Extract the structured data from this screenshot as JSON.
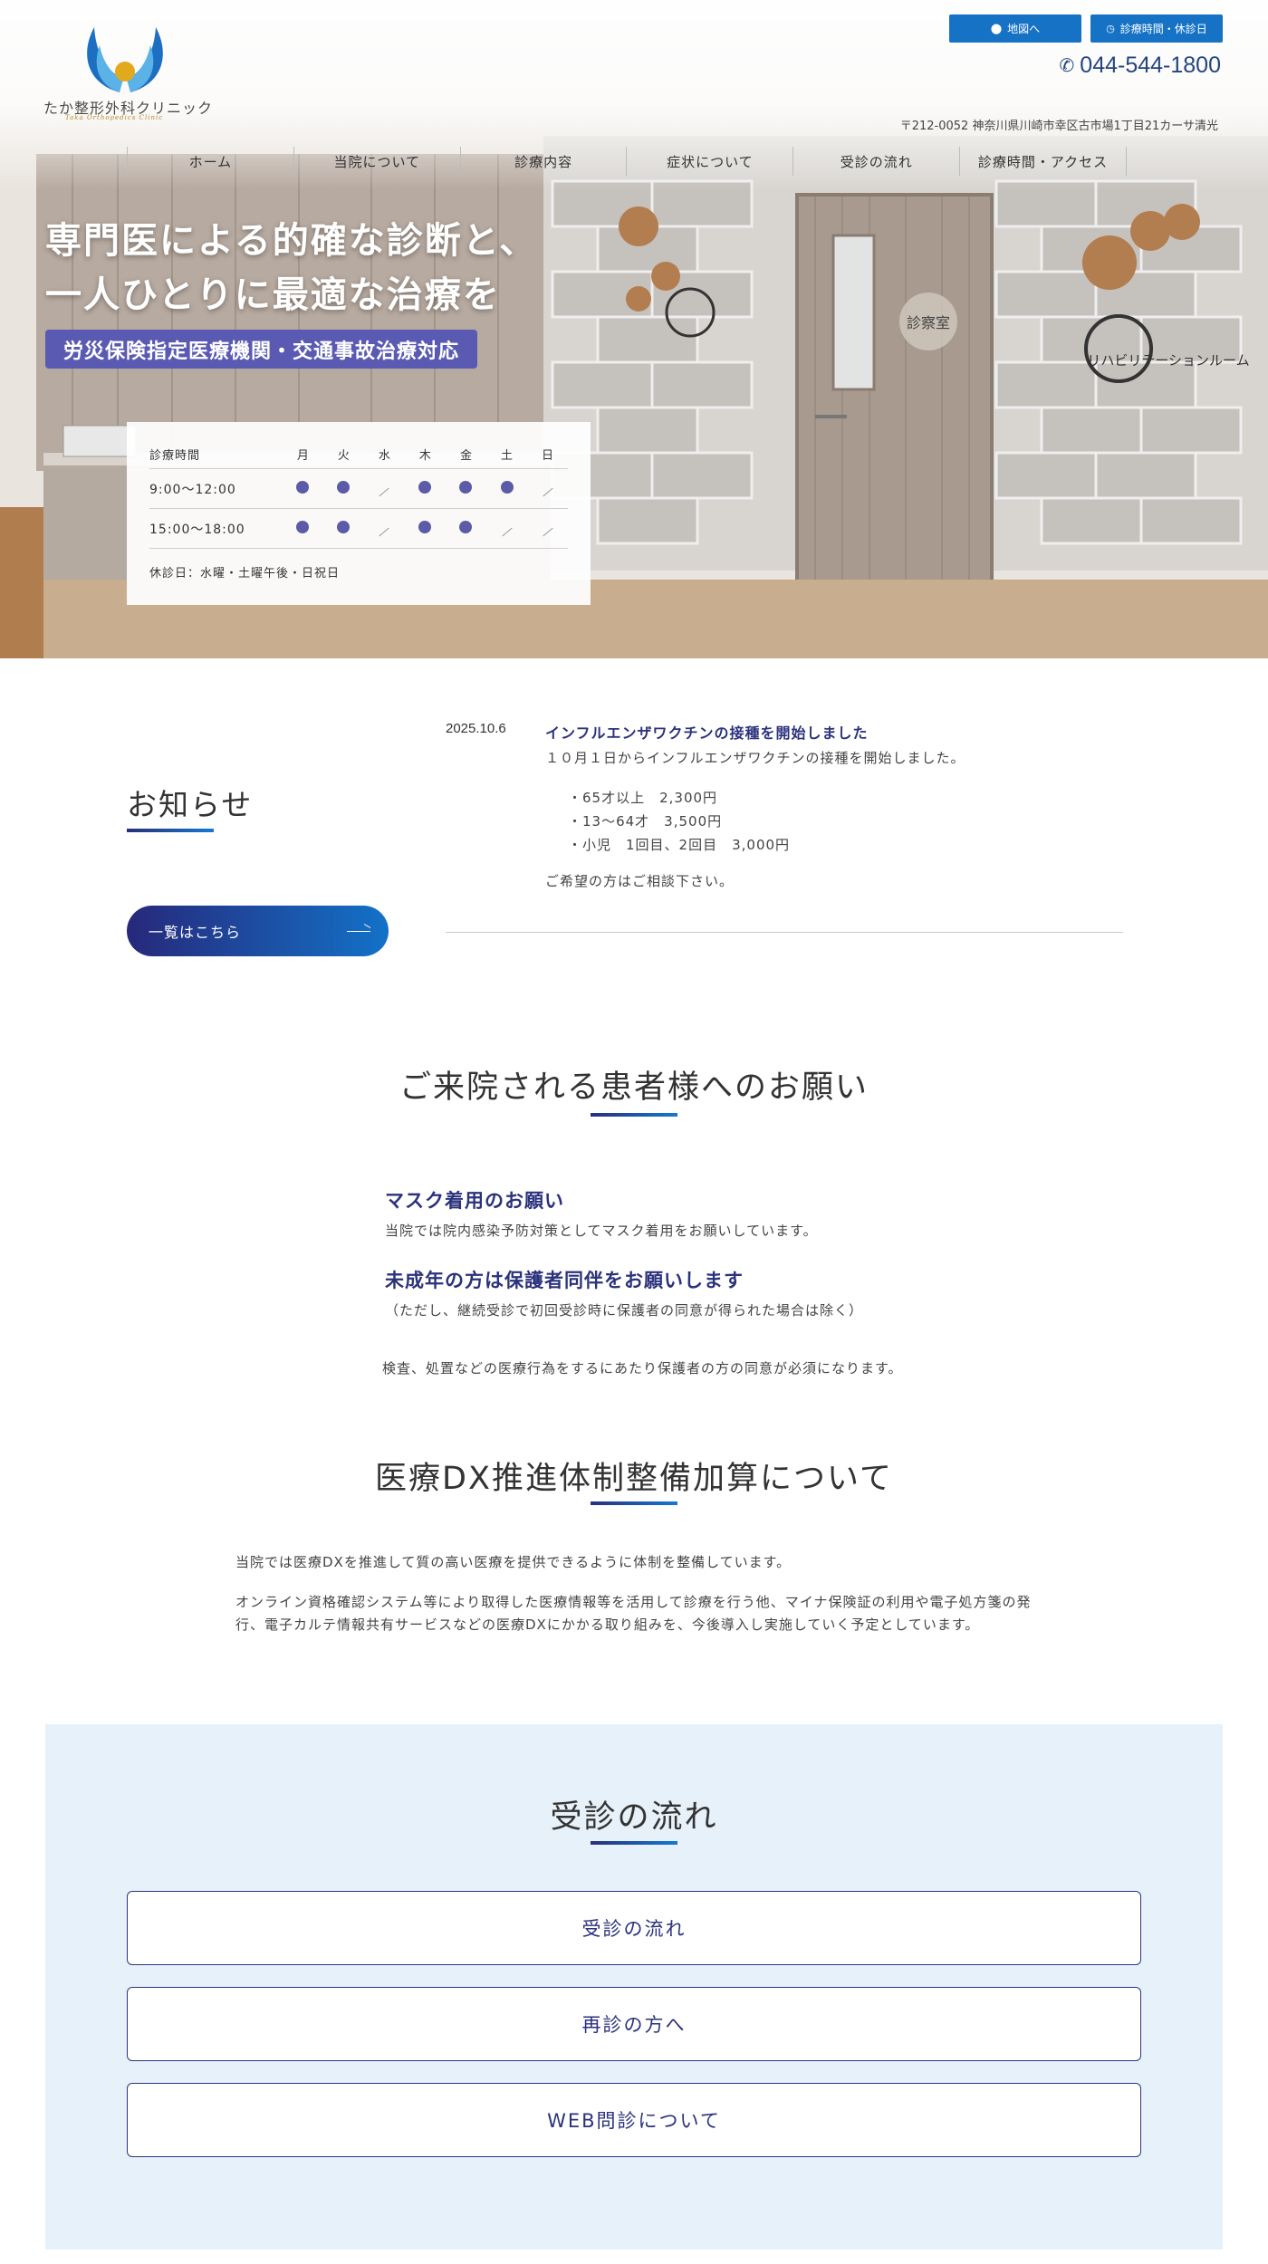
{
  "header": {
    "logo_text": "たか整形外科クリニック",
    "logo_sub": "Taka Orthopedics Clinic",
    "map_button": "地図へ",
    "hours_button": "診療時間・休診日",
    "phone": "044-544-1800",
    "address": "〒212-0052 神奈川県川崎市幸区古市場1丁目21カーサ清光"
  },
  "nav": {
    "items": [
      {
        "label": "ホーム"
      },
      {
        "label": "当院について"
      },
      {
        "label": "診療内容"
      },
      {
        "label": "症状について"
      },
      {
        "label": "受診の流れ"
      },
      {
        "label": "診療時間・アクセス"
      }
    ]
  },
  "hero": {
    "catch_line1": "専門医による的確な診断と、",
    "catch_line2": "一人ひとりに最適な治療を",
    "badge": "労災保険指定医療機関・交通事故治療対応",
    "sign_room": "診察室",
    "sign_rehab": "リハビリテーションルーム"
  },
  "hours": {
    "header_label": "診療時間",
    "days": [
      "月",
      "火",
      "水",
      "木",
      "金",
      "土",
      "日"
    ],
    "rows": [
      {
        "time": "9:00〜12:00",
        "open": [
          true,
          true,
          false,
          true,
          true,
          true,
          false
        ]
      },
      {
        "time": "15:00〜18:00",
        "open": [
          true,
          true,
          false,
          true,
          true,
          false,
          false
        ]
      }
    ],
    "holiday": "休診日：水曜・土曜午後・日祝日"
  },
  "news": {
    "title": "お知らせ",
    "more_button": "一覧はこちら",
    "date": "2025.10.6",
    "headline": "インフルエンザワクチンの接種を開始しました",
    "body": "１０月１日からインフルエンザワクチンの接種を開始しました。",
    "list": [
      "・65才以上　2,300円",
      "・13〜64才　3,500円",
      "・小児　1回目、2回目　3,000円"
    ],
    "footer": "ご希望の方はご相談下さい。"
  },
  "requests": {
    "title": "ご来院される患者様へのお願い",
    "mask_heading": "マスク着用のお願い",
    "mask_text": "当院では院内感染予防対策としてマスク着用をお願いしています。",
    "minor_heading": "未成年の方は保護者同伴をお願いします",
    "minor_note": "（ただし、継続受診で初回受診時に保護者の同意が得られた場合は除く）",
    "consent_text": "検査、処置などの医療行為をするにあたり保護者の方の同意が必須になります。"
  },
  "dx": {
    "title": "医療DX推進体制整備加算について",
    "para1": "当院では医療DXを推進して質の高い医療を提供できるように体制を整備しています。",
    "para2": "オンライン資格確認システム等により取得した医療情報等を活用して診療を行う他、マイナ保険証の利用や電子処方箋の発行、電子カルテ情報共有サービスなどの医療DXにかかる取り組みを、今後導入し実施していく予定としています。"
  },
  "flow": {
    "title": "受診の流れ",
    "buttons": [
      {
        "label": "受診の流れ"
      },
      {
        "label": "再診の方へ"
      },
      {
        "label": "WEB問診について"
      }
    ]
  },
  "colors": {
    "primary_blue": "#1572c5",
    "navy": "#2b327c",
    "dot_purple": "#5b5ba8",
    "flow_bg": "#e7f1f9"
  }
}
